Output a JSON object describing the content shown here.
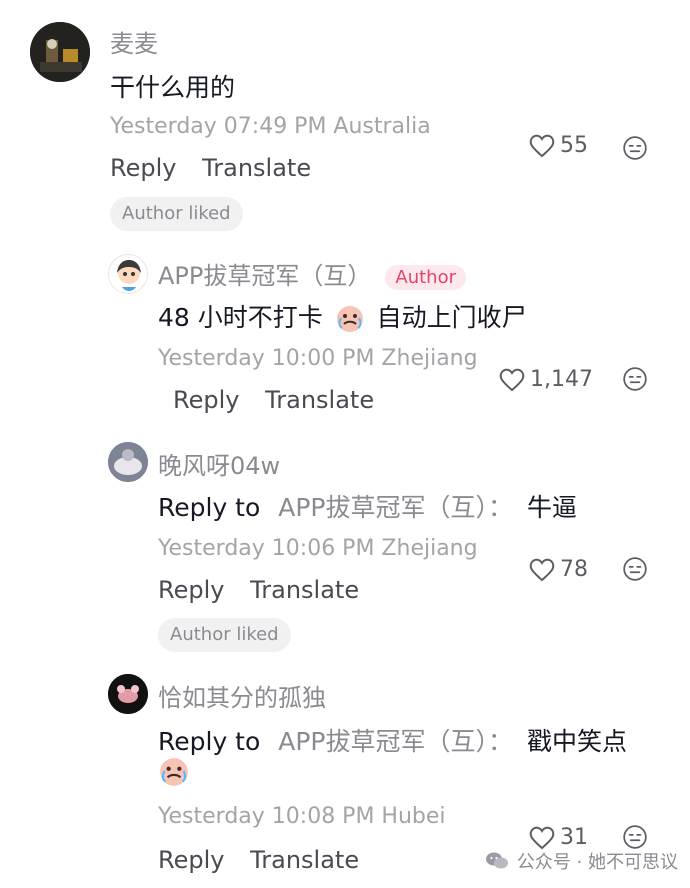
{
  "comments": [
    {
      "username": "麦麦",
      "text": "干什么用的",
      "meta": "Yesterday 07:49 PM Australia",
      "likes": "55",
      "author_liked": "Author liked"
    },
    {
      "username": "APP拔草冠军（互）",
      "author_tag": "Author",
      "text_part1": "48 小时不打卡",
      "text_part2": "自动上门收尸",
      "meta": "Yesterday 10:00 PM Zhejiang",
      "likes": "1,147"
    },
    {
      "username": "晚风呀04w",
      "reply_prefix": "Reply to",
      "reply_target": "APP拔草冠军（互）：",
      "text": "牛逼",
      "meta": "Yesterday 10:06 PM Zhejiang",
      "likes": "78",
      "author_liked": "Author liked"
    },
    {
      "username": "恰如其分的孤独",
      "reply_prefix": "Reply to",
      "reply_target": "APP拔草冠军（互）：",
      "text": "戳中笑点",
      "meta": "Yesterday 10:08 PM Hubei",
      "likes": "31"
    }
  ],
  "actions": {
    "reply": "Reply",
    "translate": "Translate"
  },
  "watermark": "公众号 · 她不可思议",
  "icons": {
    "like": "heart-outline-icon",
    "dislike": "meh-face-icon",
    "wechat": "wechat-icon"
  }
}
